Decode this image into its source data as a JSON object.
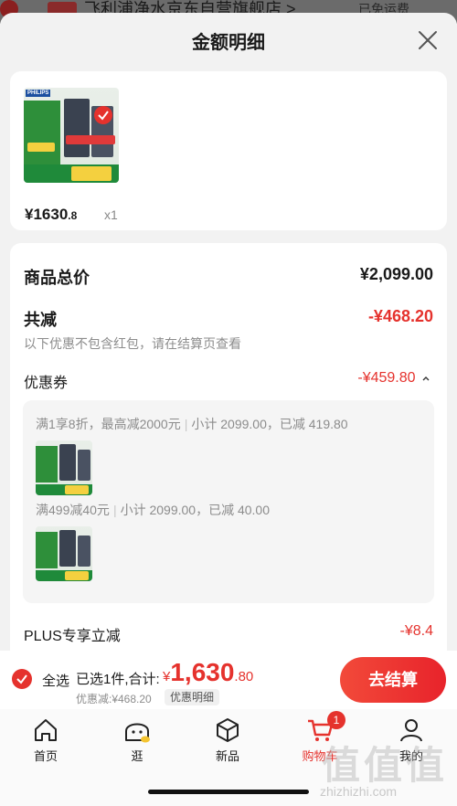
{
  "behind": {
    "tag": "",
    "shop_name": "飞利浦净水京东自营旗舰店 >",
    "shipping": "已免运费"
  },
  "sheet": {
    "title": "金额明细"
  },
  "product": {
    "brand": "PHILIPS",
    "price_int": "¥1630",
    "price_dec": ".8",
    "qty": "x1"
  },
  "summary": {
    "goods_total_label": "商品总价",
    "goods_total_value": "¥2,099.00",
    "reduced_label": "共减",
    "reduced_value": "-¥468.20",
    "note": "以下优惠不包含红包，请在结算页查看",
    "coupon_label": "优惠券",
    "coupon_value": "-¥459.80",
    "coupon_toggle_icon": "chevron-up",
    "coupons": [
      {
        "rule": "满1享8折，最高减2000元",
        "detail": "小计 2099.00，已减 419.80"
      },
      {
        "rule": "满499减40元",
        "detail": "小计 2099.00，已减 40.00"
      }
    ],
    "plus_label": "PLUS专享立减",
    "plus_value": "-¥8.4"
  },
  "bottom": {
    "select_all": "全选",
    "selected": "已选1件,合计:",
    "total_currency": "¥",
    "total_int": "1,630",
    "total_dec": ".80",
    "discount": "优惠减:¥468.20",
    "detail_link": "优惠明细",
    "checkout": "去结算"
  },
  "tabbar": {
    "items": [
      {
        "label": "首页",
        "icon": "home-icon"
      },
      {
        "label": "逛",
        "icon": "face-icon"
      },
      {
        "label": "新品",
        "icon": "cube-icon"
      },
      {
        "label": "购物车",
        "icon": "cart-icon",
        "badge": "1",
        "active": true
      },
      {
        "label": "我的",
        "icon": "user-icon"
      }
    ]
  },
  "watermark": {
    "big": "值值值",
    "url": "zhizhizhi.com"
  },
  "colors": {
    "accent": "#e5322d",
    "price_red": "#e5322d"
  }
}
